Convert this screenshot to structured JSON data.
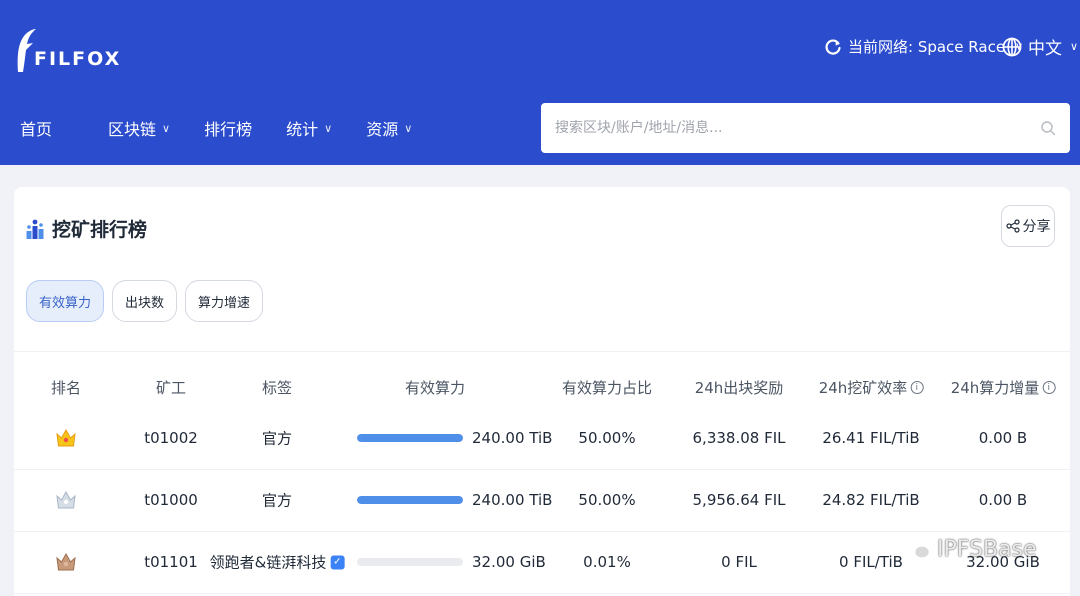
{
  "brand": {
    "name": "FILFOX"
  },
  "network": {
    "label": "当前网络: Space Race"
  },
  "language": {
    "label": "中文"
  },
  "nav": {
    "items": [
      {
        "label": "首页",
        "dropdown": false
      },
      {
        "label": "区块链",
        "dropdown": true
      },
      {
        "label": "排行榜",
        "dropdown": false
      },
      {
        "label": "统计",
        "dropdown": true
      },
      {
        "label": "资源",
        "dropdown": true
      }
    ]
  },
  "search": {
    "placeholder": "搜索区块/账户/地址/消息..."
  },
  "card": {
    "title": "挖矿排行榜",
    "share_label": "分享",
    "tabs": [
      {
        "label": "有效算力",
        "active": true
      },
      {
        "label": "出块数",
        "active": false
      },
      {
        "label": "算力增速",
        "active": false
      }
    ]
  },
  "table": {
    "headers": {
      "rank": "排名",
      "miner": "矿工",
      "tag": "标签",
      "power": "有效算力",
      "share": "有效算力占比",
      "reward": "24h出块奖励",
      "efficiency": "24h挖矿效率",
      "growth": "24h算力增量"
    },
    "rows": [
      {
        "rank_icon": "gold-crown-icon",
        "miner": "t01002",
        "tag": "官方",
        "verified": false,
        "power_fraction": 1.0,
        "power": "240.00 TiB",
        "share": "50.00%",
        "reward": "6,338.08 FIL",
        "efficiency": "26.41 FIL/TiB",
        "growth": "0.00 B"
      },
      {
        "rank_icon": "silver-crown-icon",
        "miner": "t01000",
        "tag": "官方",
        "verified": false,
        "power_fraction": 1.0,
        "power": "240.00 TiB",
        "share": "50.00%",
        "reward": "5,956.64 FIL",
        "efficiency": "24.82 FIL/TiB",
        "growth": "0.00 B"
      },
      {
        "rank_icon": "bronze-crown-icon",
        "miner": "t01101",
        "tag": "领跑者&链湃科技",
        "verified": true,
        "power_fraction": 0.0001,
        "power": "32.00 GiB",
        "share": "0.01%",
        "reward": "0 FIL",
        "efficiency": "0 FIL/TiB",
        "growth": "32.00 GiB"
      }
    ]
  },
  "watermark": {
    "text": "IPFSBase"
  },
  "colors": {
    "header": "#2b4ccc",
    "bar": "#4f8fea",
    "active_tab_bg": "#e6eefc",
    "gold": "#f5c518",
    "silver": "#c3cedb",
    "bronze": "#b88d6e"
  }
}
